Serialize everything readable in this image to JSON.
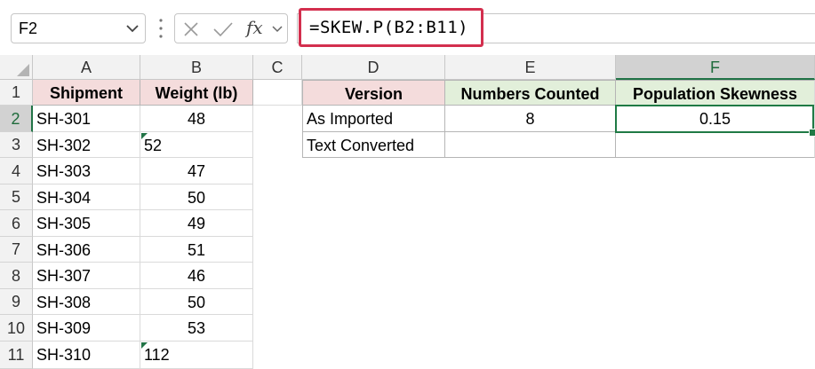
{
  "formula_bar": {
    "name_box": "F2",
    "fx_label": "fx",
    "formula": "=SKEW.P(B2:B11)"
  },
  "columns": [
    "A",
    "B",
    "C",
    "D",
    "E",
    "F"
  ],
  "rows": [
    "1",
    "2",
    "3",
    "4",
    "5",
    "6",
    "7",
    "8",
    "9",
    "10",
    "11"
  ],
  "table_left": {
    "headers": [
      "Shipment",
      "Weight (lb)"
    ],
    "rows": [
      {
        "shipment": "SH-301",
        "weight": "48"
      },
      {
        "shipment": "SH-302",
        "weight": "52"
      },
      {
        "shipment": "SH-303",
        "weight": "47"
      },
      {
        "shipment": "SH-304",
        "weight": "50"
      },
      {
        "shipment": "SH-305",
        "weight": "49"
      },
      {
        "shipment": "SH-306",
        "weight": "51"
      },
      {
        "shipment": "SH-307",
        "weight": "46"
      },
      {
        "shipment": "SH-308",
        "weight": "50"
      },
      {
        "shipment": "SH-309",
        "weight": "53"
      },
      {
        "shipment": "SH-310",
        "weight": "112"
      }
    ]
  },
  "table_right": {
    "headers": [
      "Version",
      "Numbers Counted",
      "Population Skewness"
    ],
    "rows": [
      {
        "version": "As Imported",
        "counted": "8",
        "skewness": "0.15"
      },
      {
        "version": "Text Converted",
        "counted": "",
        "skewness": ""
      }
    ]
  },
  "active_cell": "F2",
  "colors": {
    "header_pink": "#f4dcdc",
    "header_green": "#e2efda",
    "selection": "#1f7a45",
    "formula_highlight": "#d32f4e"
  }
}
